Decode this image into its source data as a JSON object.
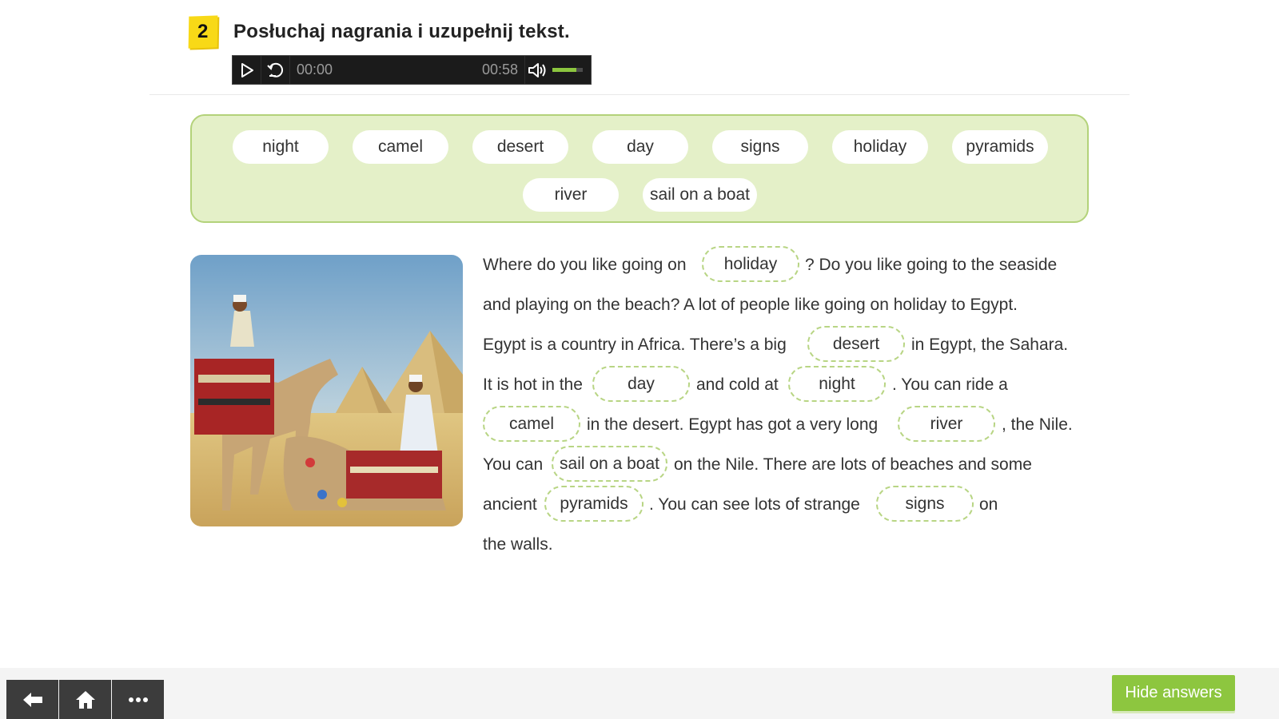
{
  "exercise": {
    "number": "2",
    "title": "Posłuchaj nagrania i uzupełnij tekst."
  },
  "player": {
    "current_time": "00:00",
    "duration": "00:58",
    "volume_fraction": 0.8
  },
  "word_bank": [
    "night",
    "camel",
    "desert",
    "day",
    "signs",
    "holiday",
    "pyramids",
    "river",
    "sail on a boat"
  ],
  "text": {
    "l1_a": "Where do you like going on",
    "l1_b": "? Do you like going to the seaside",
    "l2": "and playing on the beach? A lot of people like going on holiday to Egypt.",
    "l3_a": "Egypt is a country in Africa. There’s a big",
    "l3_b": "in Egypt, the Sahara.",
    "l4_a": "It is hot in the",
    "l4_b": "and cold at",
    "l4_c": ". You can ride a",
    "l5_a": "in the desert. Egypt has got a very long",
    "l5_b": ", the Nile.",
    "l6_a": "You can",
    "l6_b": "on the Nile. There are lots of beaches and some",
    "l7_a": "ancient",
    "l7_b": ". You can see lots of strange",
    "l7_c": "on",
    "l8": "the walls."
  },
  "answers": {
    "g1": "holiday",
    "g2": "desert",
    "g3": "day",
    "g4": "night",
    "g5": "camel",
    "g6": "river",
    "g7": "sail on a boat",
    "g8": "pyramids",
    "g9": "signs"
  },
  "bottom_bar": {
    "hide_answers_label": "Hide answers",
    "icons": [
      "back-arrow-icon",
      "home-icon",
      "more-icon"
    ]
  },
  "colors": {
    "accent_green": "#8dc63f",
    "bank_bg": "#e4f0c8",
    "number_yellow": "#f8d917"
  }
}
